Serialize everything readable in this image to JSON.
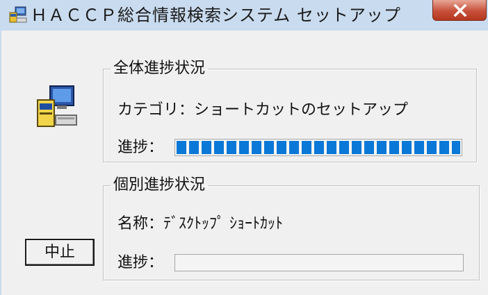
{
  "window": {
    "title": "ＨＡＣＣＰ総合情報検索システム セットアップ"
  },
  "titlebar": {
    "close_icon": "close-x-icon",
    "app_icon": "setup-computer-icon"
  },
  "overall": {
    "legend": "全体進捗状況",
    "category_text": "カテゴリ：ショートカットのセットアップ",
    "progress_label": "進捗：",
    "progress": 1.0
  },
  "individual": {
    "legend": "個別進捗状況",
    "name_text": "名称：ﾃﾞｽｸﾄｯﾌﾟ ｼｮｰﾄｶｯﾄ",
    "progress_label": "進捗：",
    "progress": 0.0
  },
  "buttons": {
    "cancel_label": "中止"
  },
  "colors": {
    "progress": "#0a78d6",
    "titlebar": "#c9dbee",
    "close": "#c7503b"
  }
}
